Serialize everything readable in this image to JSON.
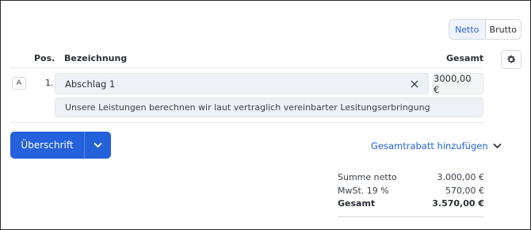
{
  "toggle": {
    "netto": "Netto",
    "brutto": "Brutto",
    "active": "Netto"
  },
  "table": {
    "headers": {
      "pos": "Pos.",
      "bezeichnung": "Bezeichnung",
      "gesamt": "Gesamt"
    },
    "rows": [
      {
        "badge": "A",
        "pos": "1.",
        "name": "Abschlag 1",
        "total": "3000,00 €",
        "description": "Unsere Leistungen berechnen wir laut vertraglich vereinbarter Lesitungserbringung"
      }
    ]
  },
  "actions": {
    "heading_button": "Überschrift",
    "discount_link": "Gesamtrabatt hinzufügen"
  },
  "summary": {
    "rows": [
      {
        "label": "Summe netto",
        "value": "3.000,00 €"
      },
      {
        "label": "MwSt. 19 %",
        "value": "570,00 €"
      },
      {
        "label": "Gesamt",
        "value": "3.570,00 €"
      }
    ]
  },
  "colors": {
    "accent": "#2461da",
    "field_bg": "#eef1f5"
  }
}
